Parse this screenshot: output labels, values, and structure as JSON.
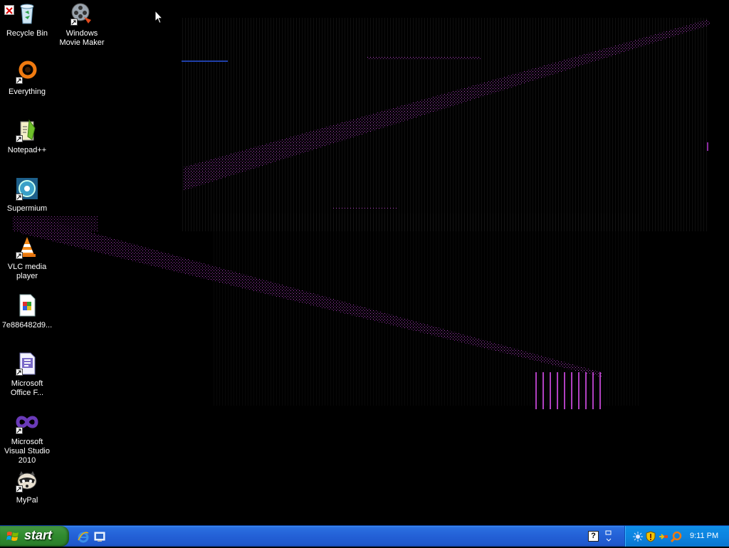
{
  "desktop": {
    "icons": [
      {
        "label": "Recycle Bin",
        "icon": "recycle-bin-icon"
      },
      {
        "label": "Windows Movie Maker",
        "icon": "movie-maker-icon"
      },
      {
        "label": "Everything",
        "icon": "everything-search-icon"
      },
      {
        "label": "Notepad++",
        "icon": "notepad-plus-plus-icon"
      },
      {
        "label": "Supermium",
        "icon": "supermium-browser-icon"
      },
      {
        "label": "VLC media player",
        "icon": "vlc-cone-icon"
      },
      {
        "label": "7e886482d9...",
        "icon": "image-file-icon"
      },
      {
        "label": "Microsoft Office F...",
        "icon": "office-file-icon"
      },
      {
        "label": "Microsoft Visual Studio 2010",
        "icon": "visual-studio-icon"
      },
      {
        "label": "MyPal",
        "icon": "mypal-raccoon-icon"
      }
    ]
  },
  "taskbar": {
    "start_label": "start",
    "quick_launch": [
      "internet-explorer-icon",
      "show-desktop-icon"
    ],
    "help_label": "?",
    "tray_icons": [
      "network-icon",
      "security-shield-icon",
      "speaker-icon",
      "search-icon"
    ],
    "clock": "9:11 PM"
  },
  "colors": {
    "desktop_bg": "#000000",
    "taskbar_blue": "#245edb",
    "start_green": "#3c9a3b",
    "tray_blue": "#0f8be8",
    "artifact_magenta": "#b040c0"
  }
}
